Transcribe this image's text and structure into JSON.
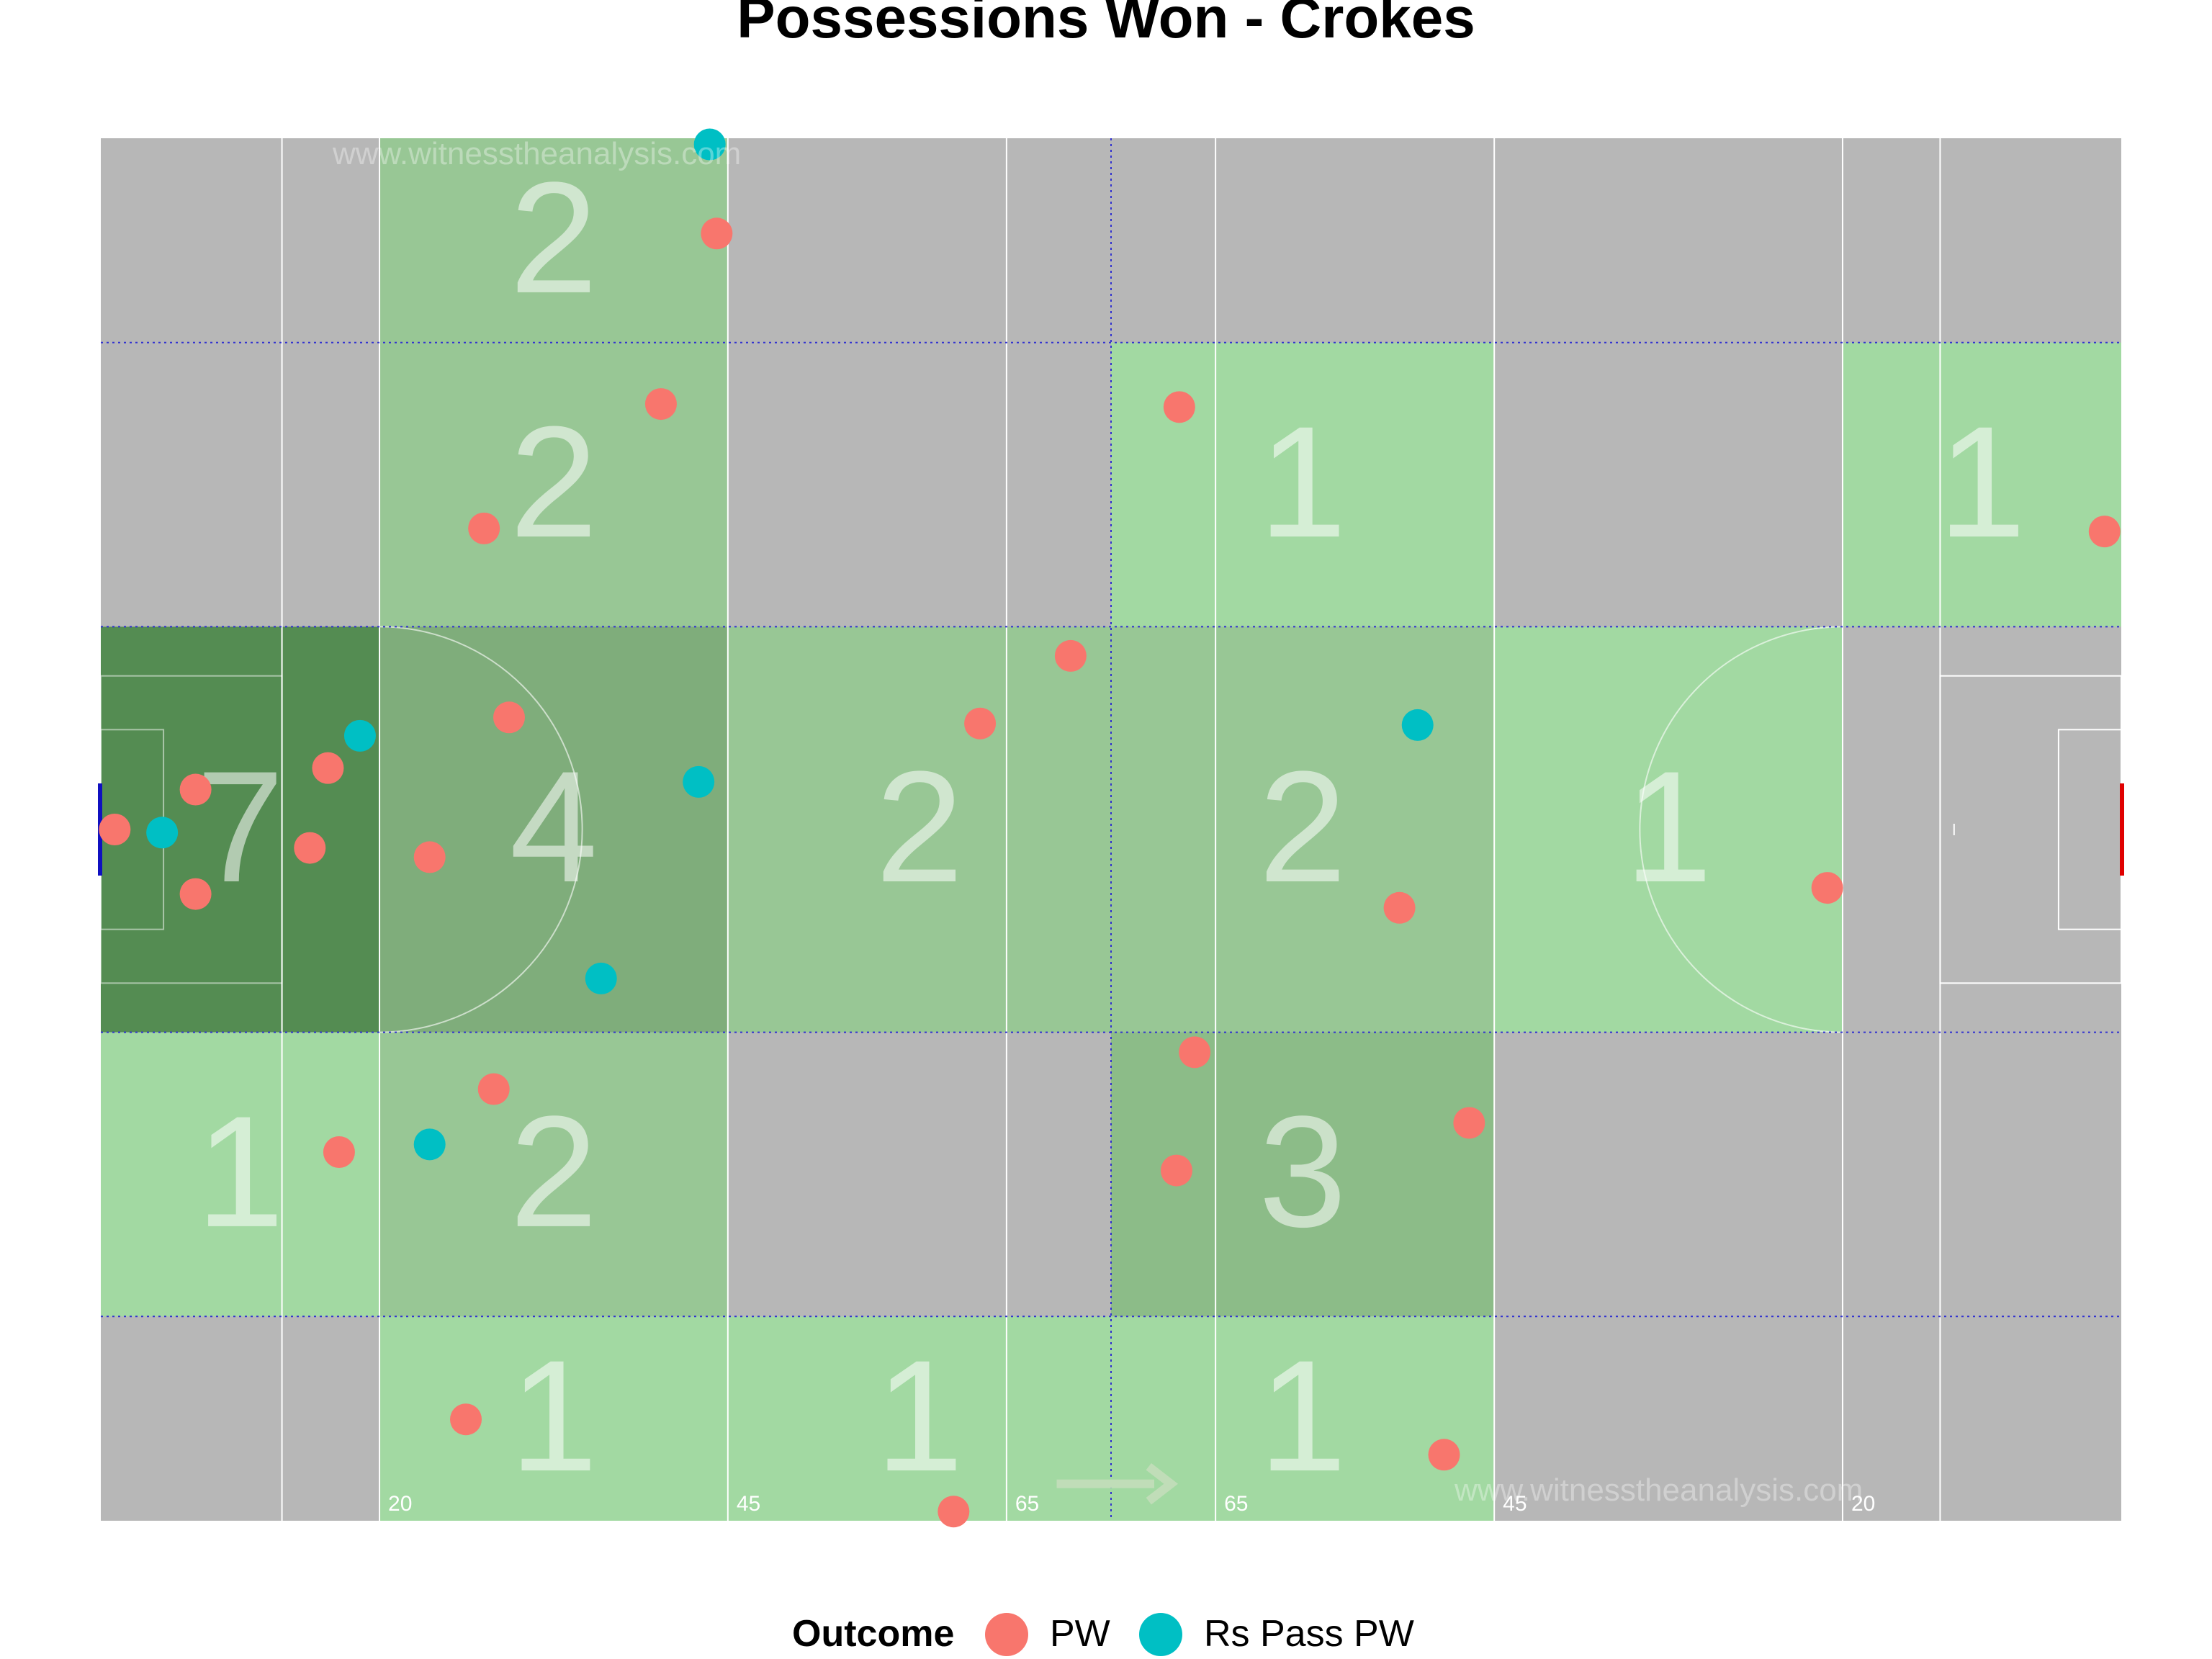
{
  "chart_data": {
    "type": "scatter",
    "title": "Possessions Won - Crokes",
    "watermarks": [
      "www.witnesstheanalysis.com",
      "www.witnesstheanalysis.com"
    ],
    "pitch": {
      "length": 145,
      "width": 90,
      "distance_labels": [
        {
          "text": "20",
          "x": 20
        },
        {
          "text": "45",
          "x": 45
        },
        {
          "text": "65",
          "x": 65
        },
        {
          "text": "65",
          "x": 80
        },
        {
          "text": "45",
          "x": 100
        },
        {
          "text": "20",
          "x": 125
        }
      ]
    },
    "zones": [
      {
        "x": [
          20,
          45
        ],
        "y": [
          76.7,
          90
        ],
        "count": "2"
      },
      {
        "x": [
          20,
          45
        ],
        "y": [
          58.2,
          76.7
        ],
        "count": "2"
      },
      {
        "x": [
          72.5,
          100
        ],
        "y": [
          58.2,
          76.7
        ],
        "count": "1"
      },
      {
        "x": [
          125,
          145
        ],
        "y": [
          58.2,
          76.7
        ],
        "count": "1"
      },
      {
        "x": [
          0,
          20
        ],
        "y": [
          31.8,
          58.2
        ],
        "count": "7"
      },
      {
        "x": [
          20,
          45
        ],
        "y": [
          31.8,
          58.2
        ],
        "count": "4"
      },
      {
        "x": [
          45,
          72.5
        ],
        "y": [
          31.8,
          58.2
        ],
        "count": "2"
      },
      {
        "x": [
          72.5,
          100
        ],
        "y": [
          31.8,
          58.2
        ],
        "count": "2"
      },
      {
        "x": [
          100,
          125
        ],
        "y": [
          31.8,
          58.2
        ],
        "count": "1"
      },
      {
        "x": [
          0,
          20
        ],
        "y": [
          13.3,
          31.8
        ],
        "count": "1"
      },
      {
        "x": [
          20,
          45
        ],
        "y": [
          13.3,
          31.8
        ],
        "count": "2"
      },
      {
        "x": [
          72.5,
          100
        ],
        "y": [
          13.3,
          31.8
        ],
        "count": "3"
      },
      {
        "x": [
          20,
          45
        ],
        "y": [
          0,
          13.3
        ],
        "count": "1"
      },
      {
        "x": [
          45,
          72.5
        ],
        "y": [
          0,
          13.3
        ],
        "count": "1"
      },
      {
        "x": [
          72.5,
          100
        ],
        "y": [
          0,
          13.3
        ],
        "count": "1"
      }
    ],
    "zone_colors": {
      "1": "#a2d9a2",
      "2": "#98c795",
      "3": "#8cbc88",
      "4": "#7fad7b",
      "7": "#548c52"
    },
    "empty_zone_color": "#b7b7b7",
    "series": [
      {
        "name": "PW",
        "color": "#f8766d",
        "points": [
          {
            "x": 44.2,
            "y": 83.8
          },
          {
            "x": 40.2,
            "y": 72.7
          },
          {
            "x": 27.5,
            "y": 64.6
          },
          {
            "x": 69.6,
            "y": 56.3
          },
          {
            "x": 63.1,
            "y": 51.9
          },
          {
            "x": 29.3,
            "y": 52.3
          },
          {
            "x": 16.3,
            "y": 49.0
          },
          {
            "x": 6.8,
            "y": 47.6
          },
          {
            "x": 1.0,
            "y": 45.0
          },
          {
            "x": 15.0,
            "y": 43.8
          },
          {
            "x": 23.6,
            "y": 43.2
          },
          {
            "x": 6.8,
            "y": 40.8
          },
          {
            "x": 93.2,
            "y": 39.9
          },
          {
            "x": 123.9,
            "y": 41.2
          },
          {
            "x": 78.5,
            "y": 30.5
          },
          {
            "x": 28.2,
            "y": 28.1
          },
          {
            "x": 17.1,
            "y": 24.0
          },
          {
            "x": 98.2,
            "y": 25.9
          },
          {
            "x": 77.2,
            "y": 22.8
          },
          {
            "x": 26.2,
            "y": 6.6
          },
          {
            "x": 96.4,
            "y": 4.3
          },
          {
            "x": 61.2,
            "y": 0.6
          },
          {
            "x": 143.8,
            "y": 64.4
          },
          {
            "x": 77.4,
            "y": 72.5
          }
        ]
      },
      {
        "name": "Rs Pass PW",
        "color": "#00bfc4",
        "points": [
          {
            "x": 43.7,
            "y": 89.6
          },
          {
            "x": 18.6,
            "y": 51.1
          },
          {
            "x": 42.9,
            "y": 48.1
          },
          {
            "x": 4.4,
            "y": 44.8
          },
          {
            "x": 35.9,
            "y": 35.3
          },
          {
            "x": 94.5,
            "y": 51.8
          },
          {
            "x": 23.6,
            "y": 24.5
          }
        ]
      }
    ],
    "legend": {
      "title": "Outcome",
      "placement": "bottom",
      "items": [
        "PW",
        "Rs Pass PW"
      ]
    }
  }
}
